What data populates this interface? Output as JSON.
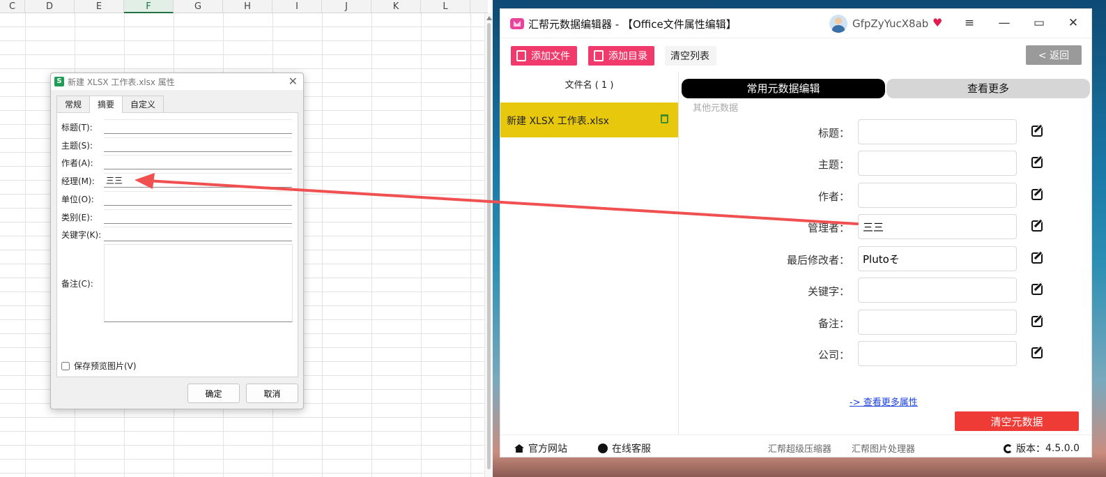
{
  "sheet": {
    "columns": [
      "C",
      "D",
      "E",
      "F",
      "G",
      "H",
      "I",
      "J",
      "K",
      "L"
    ],
    "active_column": "F"
  },
  "dialog": {
    "app_icon_letter": "S",
    "title": "新建 XLSX 工作表.xlsx 属性",
    "close_glyph": "✕",
    "tabs": [
      "常规",
      "摘要",
      "自定义"
    ],
    "active_tab": "摘要",
    "fields": [
      {
        "label": "标题(T):",
        "value": ""
      },
      {
        "label": "主题(S):",
        "value": ""
      },
      {
        "label": "作者(A):",
        "value": ""
      },
      {
        "label": "经理(M):",
        "value": "三三"
      },
      {
        "label": "单位(O):",
        "value": ""
      },
      {
        "label": "类别(E):",
        "value": ""
      },
      {
        "label": "关键字(K):",
        "value": ""
      }
    ],
    "notes_label": "备注(C):",
    "notes_value": "",
    "save_preview_label": "保存预览图片(V)",
    "save_preview_checked": false,
    "ok_label": "确定",
    "cancel_label": "取消"
  },
  "app": {
    "title": "汇帮元数据编辑器 - 【Office文件属性编辑】",
    "username": "GfpZyYucX8ab",
    "vip_icon": "heart-diamond-icon",
    "window_controls": {
      "menu": "≡",
      "minimize": "—",
      "maximize": "▭",
      "close": "✕"
    },
    "toolbar": {
      "add_file": "添加文件",
      "add_folder": "添加目录",
      "clear_list": "清空列表",
      "back": "< 返回"
    },
    "file_list": {
      "header": "文件名 ( 1 )",
      "files": [
        "新建 XLSX 工作表.xlsx"
      ]
    },
    "editor": {
      "tab_common": "常用元数据编辑",
      "tab_more": "查看更多",
      "other_meta": "其他元数据",
      "fields": [
        {
          "label": "标题：",
          "value": ""
        },
        {
          "label": "主题：",
          "value": ""
        },
        {
          "label": "作者：",
          "value": ""
        },
        {
          "label": "管理者：",
          "value": "三三"
        },
        {
          "label": "最后修改者：",
          "value": "Plutoそ"
        },
        {
          "label": "关键字：",
          "value": ""
        },
        {
          "label": "备注：",
          "value": ""
        },
        {
          "label": "公司：",
          "value": ""
        }
      ],
      "more_attrs_link": "-> 查看更多属性",
      "clear_button": "清空元数据"
    },
    "statusbar": {
      "website": "官方网站",
      "support": "在线客服",
      "compressor": "汇帮超级压缩器",
      "image_tool": "汇帮图片处理器",
      "version_label": "版本：",
      "version": "4.5.0.0"
    },
    "colors": {
      "accent_pink": "#f03a6b",
      "selected_file": "#e8c80c",
      "clear_red": "#ef3b36",
      "annotation_arrow": "#f05050"
    }
  }
}
